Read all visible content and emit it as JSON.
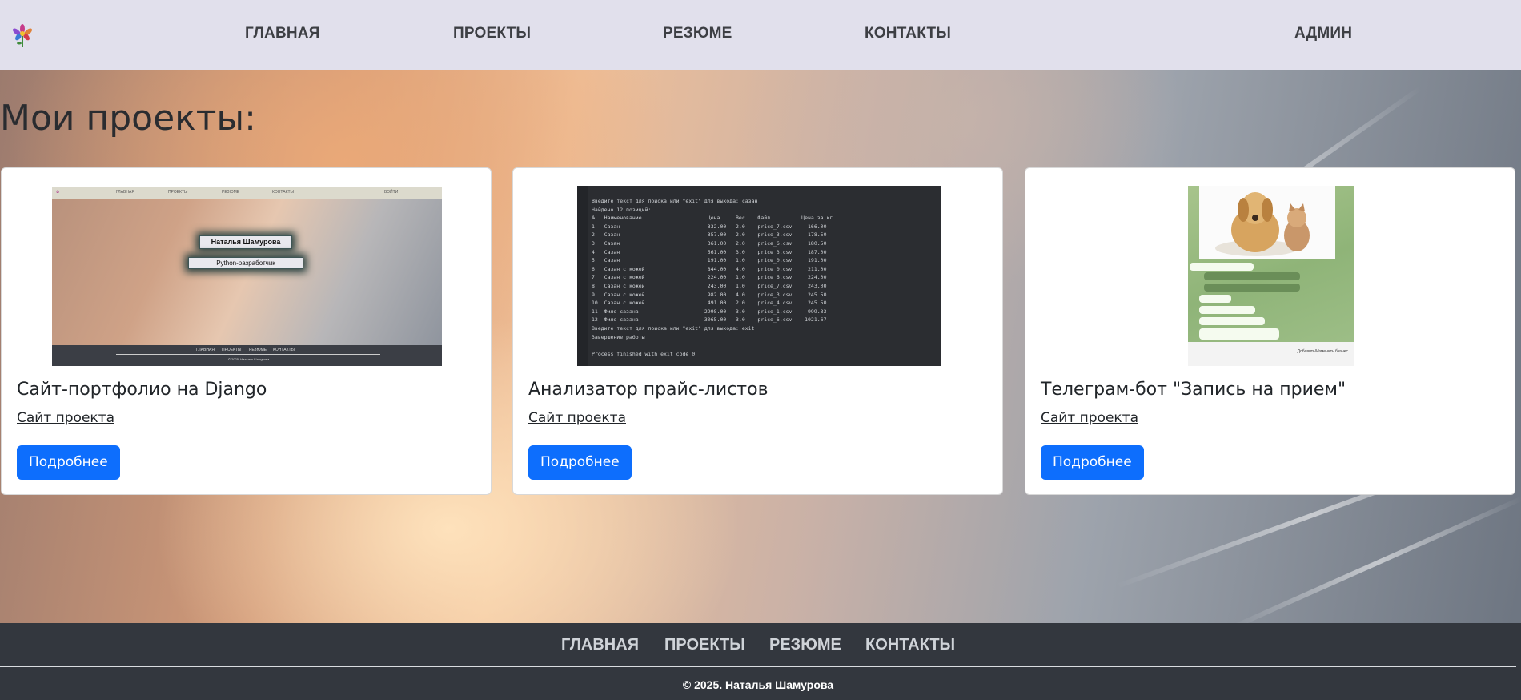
{
  "navbar": {
    "links": [
      "ГЛАВНАЯ",
      "ПРОЕКТЫ",
      "РЕЗЮМЕ",
      "КОНТАКТЫ"
    ],
    "admin": "АДМИН",
    "logo_icon": "flower-logo-icon"
  },
  "main": {
    "title": "Мои проекты:",
    "cards": [
      {
        "title": "Сайт-портфолио на Django",
        "link": "Сайт проекта",
        "button": "Подробнее"
      },
      {
        "title": "Анализатор прайс-листов",
        "link": "Сайт проекта",
        "button": "Подробнее"
      },
      {
        "title": "Телеграм-бот \"Запись на прием\"",
        "link": "Сайт проекта",
        "button": "Подробнее"
      }
    ]
  },
  "thumb1": {
    "nav": [
      "ГЛАВНАЯ",
      "ПРОЕКТЫ",
      "РЕЗЮМЕ",
      "КОНТАКТЫ",
      "ВОЙТИ"
    ],
    "name": "Наталья Шамурова",
    "role": "Python-разработчик",
    "footer": [
      "ГЛАВНАЯ",
      "ПРОЕКТЫ",
      "РЕЗЮМЕ",
      "КОНТАКТЫ"
    ],
    "copyright": "© 2025. Наталья Шамурова"
  },
  "thumb2": {
    "lines": "Введите текст для поиска или \"exit\" для выхода: сазан\nНайдено 12 позиций:\n№   Наименование                     Цена     Вес    Файл          Цена за кг.\n1   Сазан                            332.00   2.0    price_7.csv     166.00\n2   Сазан                            357.00   2.0    price_3.csv     178.50\n3   Сазан                            361.00   2.0    price_6.csv     180.50\n4   Сазан                            561.00   3.0    price_3.csv     187.00\n5   Сазан                            191.00   1.0    price_0.csv     191.00\n6   Сазан с кожей                    844.00   4.0    price_0.csv     211.00\n7   Сазан с кожей                    224.00   1.0    price_6.csv     224.00\n8   Сазан с кожей                    243.00   1.0    price_7.csv     243.00\n9   Сазан с кожей                    982.00   4.0    price_3.csv     245.50\n10  Сазан с кожей                    491.00   2.0    price_4.csv     245.50\n11  Филе сазана                     2998.00   3.0    price_1.csv     999.33\n12  Филе сазана                     3065.00   3.0    price_6.csv    1021.67\nВведите текст для поиска или \"exit\" для выхода: exit\nЗавершение работы\n\nProcess finished with exit code 0"
  },
  "thumb3": {
    "bottom_button": "Добавить/Изменить бизнес"
  },
  "footer": {
    "links": [
      "ГЛАВНАЯ",
      "ПРОЕКТЫ",
      "РЕЗЮМЕ",
      "КОНТАКТЫ"
    ],
    "copyright": "© 2025. Наталья Шамурова"
  },
  "colors": {
    "navbar_bg": "#e1e0ec",
    "primary_button": "#0d6efd",
    "footer_bg": "#33373e"
  }
}
